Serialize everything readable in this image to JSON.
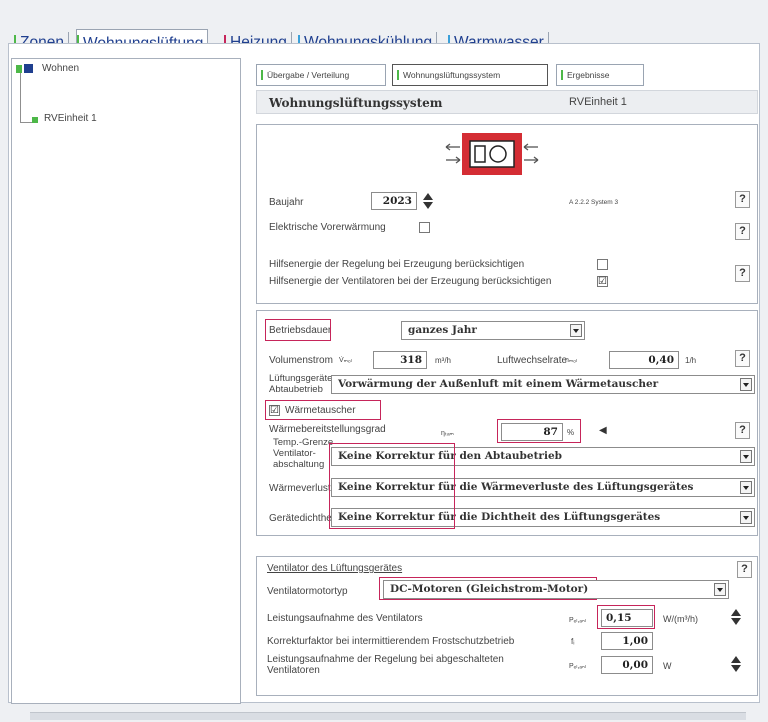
{
  "main_tabs": [
    {
      "label": "Zonen",
      "color": "#4db848"
    },
    {
      "label": "Wohnungslüftung",
      "color": "#4db848",
      "active": true
    },
    {
      "label": "Heizung",
      "color": "#c6255a"
    },
    {
      "label": "Wohnungskühlung",
      "color": "#3aa0d9"
    },
    {
      "label": "Warmwasser",
      "color": "#3aa0d9"
    }
  ],
  "tree": {
    "root": "Wohnen",
    "child": "RVEinheit 1"
  },
  "sub_tabs": [
    "Übergabe / Verteilung",
    "Wohnungslüftungssystem",
    "Ergebnisse"
  ],
  "header": {
    "title": "Wohnungslüftungssystem",
    "unit": "RVEinheit 1"
  },
  "system": {
    "baujahr_label": "Baujahr",
    "baujahr_value": "2023",
    "system_note": "A 2.2.2 System 3",
    "vorerwaermung_label": "Elektrische Vorerwärmung",
    "hilf_regelung_label": "Hilfsenergie der Regelung bei Erzeugung berücksichtigen",
    "hilf_ventilator_label": "Hilfsenergie der Ventilatoren bei der Erzeugung berücksichtigen",
    "hilf_ventilator_checked": "☑"
  },
  "operation": {
    "betriebsdauer_label": "Betriebsdauer",
    "betriebsdauer_value": "ganzes Jahr",
    "volumenstrom_label": "Volumenstrom",
    "volumenstrom_symbol": "V̇ₘₒₗ",
    "volumenstrom_value": "318",
    "volumenstrom_unit": "m³/h",
    "luftwechsel_label": "Luftwechselrate",
    "luftwechsel_symbol": "nₘₒₗ",
    "luftwechsel_value": "0,40",
    "luftwechsel_unit": "1/h",
    "abtau_label_1": "Lüftungsgeräte",
    "abtau_label_2": "Abtaubetrieb",
    "abtau_value": "Vorwärmung der Außenluft mit einem Wärmetauscher",
    "waermetauscher_label": "Wärmetauscher",
    "waermetauscher_checked": "☑",
    "grad_label": "Wärmebereitstellungsgrad",
    "grad_symbol": "ηₜₐₘ",
    "grad_value": "87",
    "grad_unit": "%",
    "temp_label": "Temp.-Grenze",
    "vent_label_1": "Ventilator-",
    "vent_label_2": "abschaltung",
    "vent_value": "Keine Korrektur für den Abtaubetrieb",
    "waermeverluste_label": "Wärmeverluste",
    "waermeverluste_value": "Keine Korrektur für die Wärmeverluste des Lüftungsgerätes",
    "dichtheit_label": "Gerätedichtheit",
    "dichtheit_value": "Keine Korrektur für die Dichtheit des Lüftungsgerätes"
  },
  "fan": {
    "section_title": "Ventilator des Lüftungsgerätes",
    "motortyp_label": "Ventilatormotortyp",
    "motortyp_value": "DC-Motoren (Gleichstrom-Motor)",
    "leistung_label": "Leistungsaufnahme des Ventilators",
    "leistung_symbol": "Pₑₗ,ₐₙₗ",
    "leistung_value": "0,15",
    "leistung_unit": "W/(m³/h)",
    "korrektur_label": "Korrekturfaktor bei intermittierendem Frostschutzbetrieb",
    "korrektur_symbol": "fᵢ",
    "korrektur_value": "1,00",
    "regelung_label_1": "Leistungsaufnahme der Regelung bei abgeschalteten",
    "regelung_label_2": "Ventilatoren",
    "regelung_symbol": "Pₑₗ,ₐₙₗ",
    "regelung_value": "0,00",
    "regelung_unit": "W"
  },
  "help_label": "?"
}
